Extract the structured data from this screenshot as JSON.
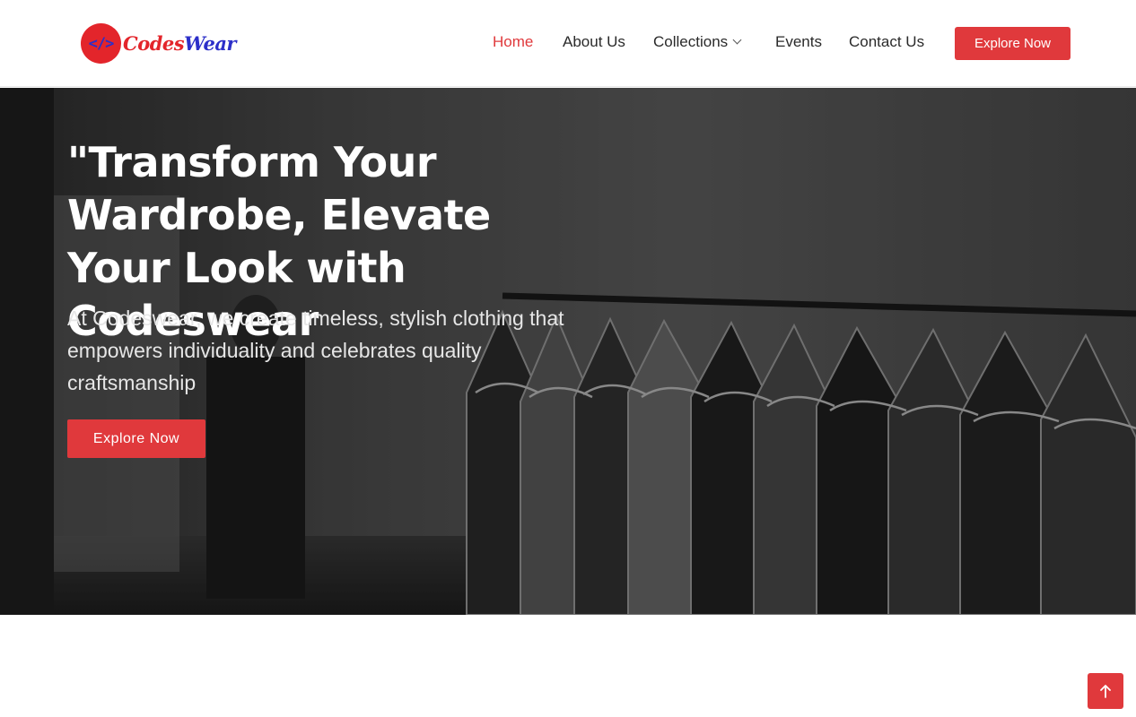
{
  "brand": {
    "logo_glyph": "</>",
    "name_part1": "Codes",
    "name_part2": "Wear",
    "colors": {
      "red": "#e3252b",
      "blue": "#2c2fc9"
    }
  },
  "nav": {
    "items": [
      {
        "label": "Home",
        "active": true
      },
      {
        "label": "About Us",
        "active": false
      },
      {
        "label": "Collections",
        "active": false,
        "has_dropdown": true
      },
      {
        "label": "Events",
        "active": false
      },
      {
        "label": "Contact Us",
        "active": false
      }
    ],
    "cta_label": "Explore Now",
    "accent_color": "#e0393c"
  },
  "hero": {
    "title": "\"Transform Your Wardrobe, Elevate Your Look with Codeswear",
    "subtitle": "At Codeswear, we create timeless, stylish clothing that empowers individuality and celebrates quality craftsmanship",
    "cta_label": "Explore Now"
  },
  "scroll_top": {
    "icon": "arrow-up-icon"
  }
}
